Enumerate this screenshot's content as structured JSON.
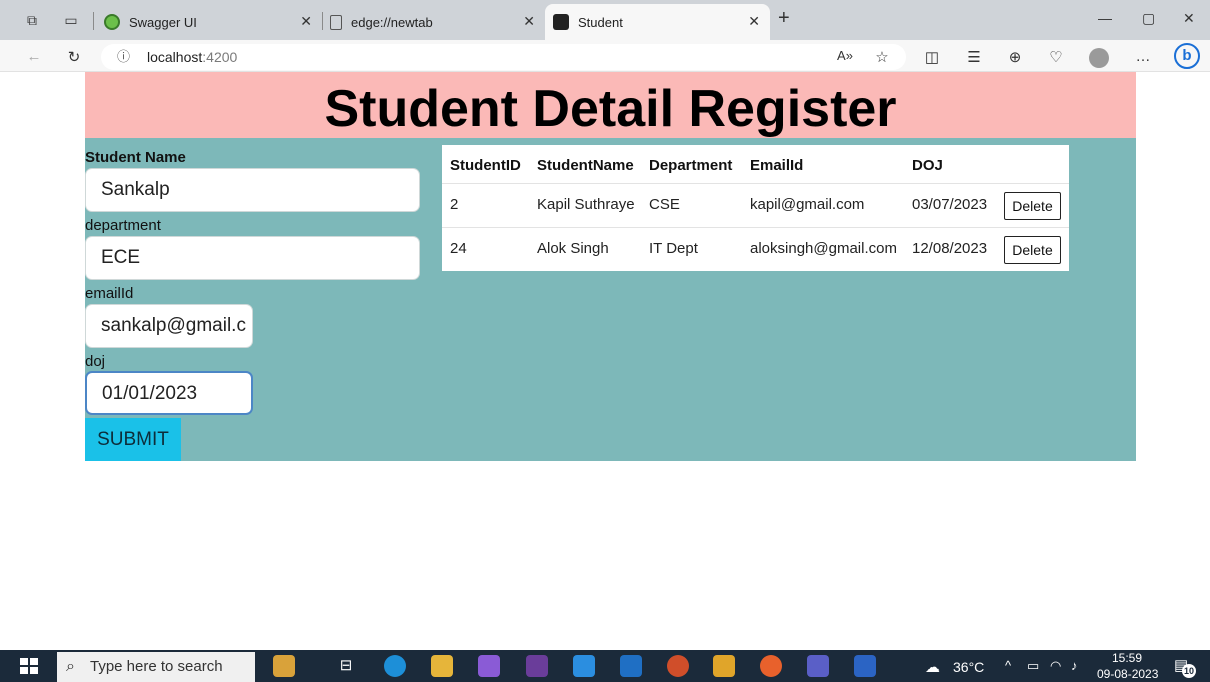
{
  "browser": {
    "tabs": [
      {
        "title": "Swagger UI"
      },
      {
        "title": "edge://newtab"
      },
      {
        "title": "Student"
      }
    ],
    "address": {
      "host": "localhost",
      "port": ":4200"
    },
    "toolbar": {
      "read_aloud": "A̩"
    }
  },
  "page": {
    "title": "Student Detail Register",
    "form": {
      "name_label": "Student Name",
      "name_value": "Sankalp",
      "department_label": "department",
      "department_value": "ECE",
      "email_label": "emailId",
      "email_value": "sankalp@gmail.c",
      "doj_label": "doj",
      "doj_value": "01/01/2023",
      "submit_label": "SUBMIT"
    },
    "table": {
      "headers": [
        "StudentID",
        "StudentName",
        "Department",
        "EmailId",
        "DOJ"
      ],
      "rows": [
        {
          "id": "2",
          "name": "Kapil Suthraye",
          "department": "CSE",
          "email": "kapil@gmail.com",
          "doj": "03/07/2023",
          "action": "Delete"
        },
        {
          "id": "24",
          "name": "Alok Singh",
          "department": "IT Dept",
          "email": "aloksingh@gmail.com",
          "doj": "12/08/2023",
          "action": "Delete"
        }
      ]
    }
  },
  "taskbar": {
    "search_placeholder": "Type here to search",
    "weather": "36°C",
    "time": "15:59",
    "date": "09-08-2023",
    "notifications": "10"
  },
  "colors": {
    "header_bg": "#fbb9b7",
    "form_bg": "#7db8b9",
    "submit_bg": "#1ac1e8"
  }
}
